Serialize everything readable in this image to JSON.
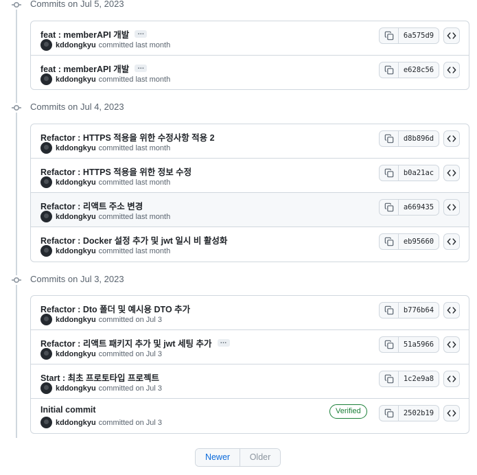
{
  "groups": [
    {
      "title": "Commits on Jul 5, 2023",
      "commits": [
        {
          "message": "feat : memberAPI 개발",
          "has_more": true,
          "author": "kddongkyu",
          "time": "committed last month",
          "sha": "6a575d9",
          "verified": false
        },
        {
          "message": "feat : memberAPI 개발",
          "has_more": true,
          "author": "kddongkyu",
          "time": "committed last month",
          "sha": "e628c56",
          "verified": false
        }
      ]
    },
    {
      "title": "Commits on Jul 4, 2023",
      "commits": [
        {
          "message": "Refactor : HTTPS 적용을 위한 수정사항 적용 2",
          "has_more": false,
          "author": "kddongkyu",
          "time": "committed last month",
          "sha": "d8b896d",
          "verified": false
        },
        {
          "message": "Refactor : HTTPS 적용을 위한 정보 수정",
          "has_more": false,
          "author": "kddongkyu",
          "time": "committed last month",
          "sha": "b0a21ac",
          "verified": false
        },
        {
          "message": "Refactor : 리액트 주소 변경",
          "has_more": false,
          "author": "kddongkyu",
          "time": "committed last month",
          "sha": "a669435",
          "verified": false
        },
        {
          "message": "Refactor : Docker 설정 추가 및 jwt 일시 비 활성화",
          "has_more": false,
          "author": "kddongkyu",
          "time": "committed last month",
          "sha": "eb95660",
          "verified": false
        }
      ]
    },
    {
      "title": "Commits on Jul 3, 2023",
      "commits": [
        {
          "message": "Refactor : Dto 폴더 및 예시용 DTO 추가",
          "has_more": false,
          "author": "kddongkyu",
          "time": "committed on Jul 3",
          "sha": "b776b64",
          "verified": false
        },
        {
          "message": "Refactor : 리액트 패키지 추가 및 jwt 세팅 추가",
          "has_more": true,
          "author": "kddongkyu",
          "time": "committed on Jul 3",
          "sha": "51a5966",
          "verified": false
        },
        {
          "message": "Start : 최초 프로토타입 프로젝트",
          "has_more": false,
          "author": "kddongkyu",
          "time": "committed on Jul 3",
          "sha": "1c2e9a8",
          "verified": false
        },
        {
          "message": "Initial commit",
          "has_more": false,
          "author": "kddongkyu",
          "time": "committed on Jul 3",
          "sha": "2502b19",
          "verified": true
        }
      ]
    }
  ],
  "verified_label": "Verified",
  "ellipsis_label": "…",
  "pagination": {
    "newer": "Newer",
    "older": "Older"
  },
  "icons": {
    "timeline": "git-commit-icon",
    "copy": "copy-icon",
    "browse": "code-icon"
  },
  "colors": {
    "link": "#0969da",
    "verified": "#1a7f37",
    "border": "#d0d7de",
    "muted": "#59636e"
  }
}
